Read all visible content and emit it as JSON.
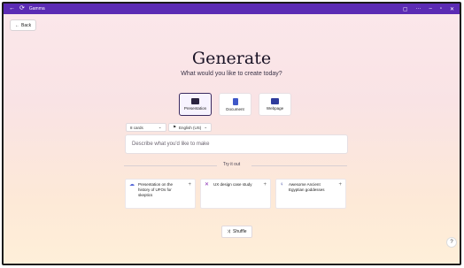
{
  "window": {
    "title": "Gamma",
    "controls": [
      "back-icon",
      "reload-icon",
      "minimize-icon",
      "maximize-icon",
      "close-icon"
    ]
  },
  "nav": {
    "back_label": "Back"
  },
  "hero": {
    "title": "Generate",
    "subtitle": "What would you like to create today?"
  },
  "types": [
    {
      "label": "Presentation",
      "icon": "presentation-icon",
      "selected": true
    },
    {
      "label": "Document",
      "icon": "document-icon",
      "selected": false
    },
    {
      "label": "Webpage",
      "icon": "webpage-icon",
      "selected": false
    }
  ],
  "options": {
    "cards": "8 cards",
    "language": "English (US)"
  },
  "prompt": {
    "placeholder": "Describe what you'd like to make"
  },
  "try_it_out": {
    "label": "Try it out"
  },
  "suggestions": [
    {
      "text": "Presentation on the history of UFOs for skeptics",
      "icon": "ufo-icon"
    },
    {
      "text": "UX design case study",
      "icon": "design-icon"
    },
    {
      "text": "Awesome Ancient Egyptian goddesses",
      "icon": "ankh-icon"
    }
  ],
  "shuffle": {
    "label": "Shuffle"
  },
  "help": {
    "label": "?"
  },
  "colors": {
    "titlebar": "#5b2bb4",
    "accent": "#3a2a60"
  }
}
